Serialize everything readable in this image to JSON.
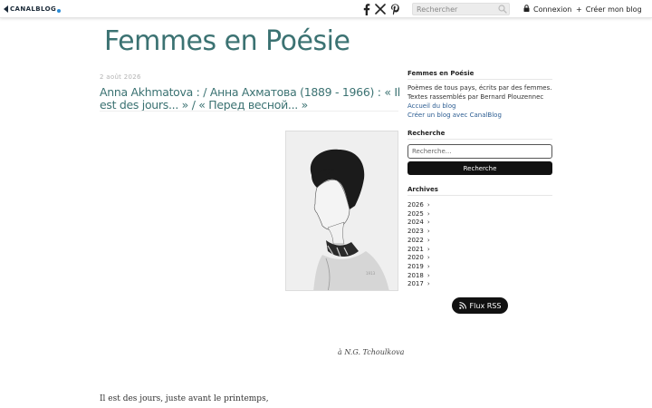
{
  "topbar": {
    "logo_text": "CANALBLOG",
    "social_icons": [
      "facebook-icon",
      "x-icon",
      "pinterest-icon"
    ],
    "search_placeholder": "Rechercher",
    "login_label": "Connexion",
    "create_blog_label": "Créer mon blog",
    "create_blog_prefix": "+"
  },
  "blog": {
    "title": "Femmes en Poésie",
    "title_color": "#3b7272"
  },
  "post": {
    "date": "2 août 2026",
    "title": "Anna Akhmatova : / Анна Ахматова (1889 - 1966) : « Il est des jours... » / « Перед весной... »",
    "image_caption": "à  N.G. Tchoulkova",
    "first_line": "Il est des jours, juste avant le printemps,"
  },
  "sidebar": {
    "about_heading": "Femmes en Poésie",
    "about_line1": "Poèmes de tous pays, écrits par des femmes.",
    "about_line2": "Textes rassemblés par Bernard Plouzennec",
    "home_link": "Accueil du blog",
    "create_link": "Créer un blog avec CanalBlog",
    "search_heading": "Recherche",
    "search_placeholder": "Recherche...",
    "search_button": "Recherche",
    "archives_heading": "Archives",
    "archives": [
      "2026",
      "2025",
      "2024",
      "2023",
      "2022",
      "2021",
      "2020",
      "2019",
      "2018",
      "2017"
    ],
    "chevron": "›",
    "rss_label": "Flux RSS"
  },
  "colors": {
    "accent": "#3b7272",
    "link": "#2c5d92",
    "button": "#111111"
  }
}
